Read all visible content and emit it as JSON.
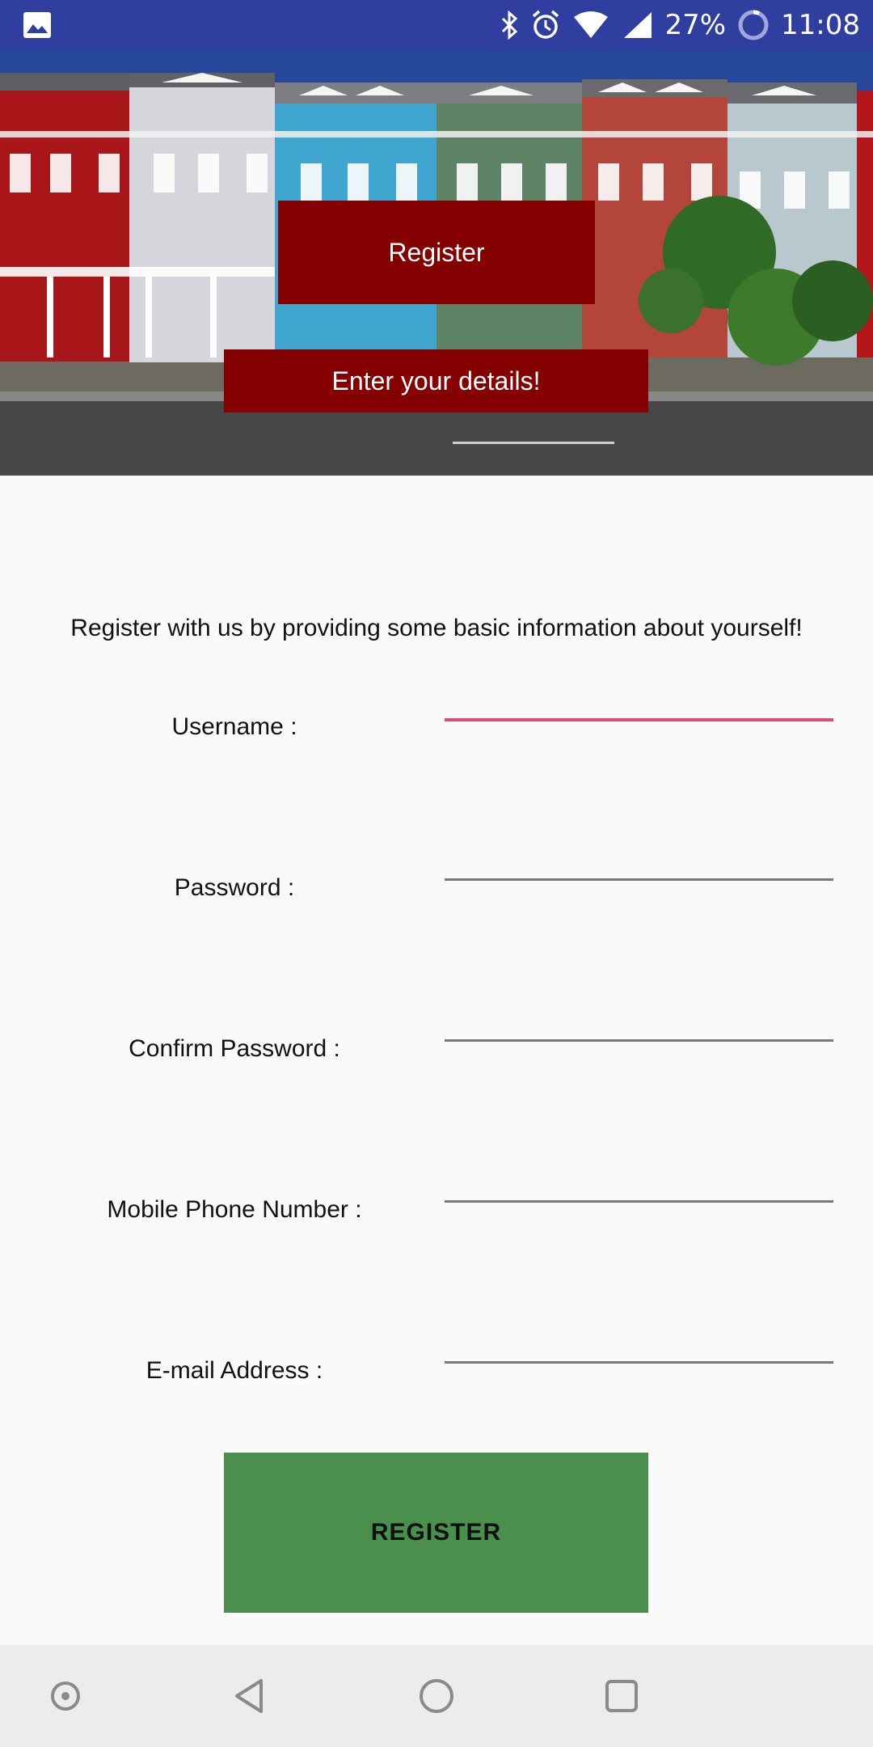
{
  "status_bar": {
    "battery": "27%",
    "time": "11:08",
    "icons": [
      "image-icon",
      "bluetooth-icon",
      "alarm-icon",
      "wifi-icon",
      "signal-icon",
      "battery-saver-icon"
    ]
  },
  "hero": {
    "title": "Register",
    "subtitle": "Enter your details!"
  },
  "form": {
    "intro": "Register with us by providing some basic information about yourself!",
    "fields": {
      "username": {
        "label": "Username :",
        "value": ""
      },
      "password": {
        "label": "Password :",
        "value": ""
      },
      "confirm_password": {
        "label": "Confirm Password :",
        "value": ""
      },
      "mobile": {
        "label": "Mobile Phone Number :",
        "value": ""
      },
      "email": {
        "label": "E-mail Address :",
        "value": ""
      }
    },
    "submit_label": "REGISTER"
  },
  "colors": {
    "status_bar": "#303f9f",
    "banner": "#850000",
    "button": "#4a8f4e",
    "focus_underline": "#e14a7c"
  },
  "nav_bar": {
    "icons": [
      "assistant-icon",
      "back-icon",
      "home-icon",
      "recents-icon"
    ]
  }
}
